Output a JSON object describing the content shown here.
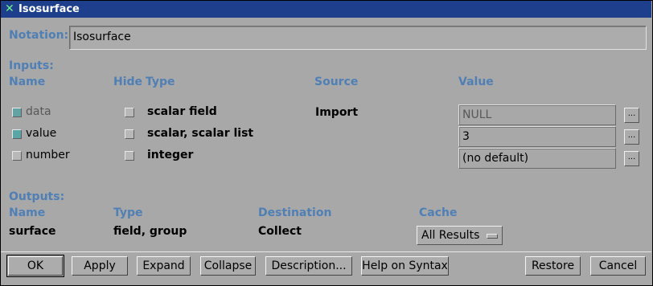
{
  "window": {
    "title": "Isosurface",
    "app_icon": "x-icon"
  },
  "notation": {
    "label": "Notation:",
    "value": "Isosurface"
  },
  "inputs": {
    "section_label": "Inputs:",
    "headers": {
      "name": "Name",
      "hide": "Hide",
      "type": "Type",
      "source": "Source",
      "value": "Value"
    },
    "rows": [
      {
        "name": "data",
        "type": "scalar field",
        "source": "Import",
        "value": "NULL",
        "enabled": false,
        "name_checked": true,
        "hide_checked": false
      },
      {
        "name": "value",
        "type": "scalar, scalar list",
        "source": "",
        "value": "3",
        "enabled": true,
        "name_checked": true,
        "hide_checked": false
      },
      {
        "name": "number",
        "type": "integer",
        "source": "",
        "value": "(no default)",
        "enabled": true,
        "name_checked": false,
        "hide_checked": false
      }
    ],
    "ellipsis_label": "..."
  },
  "outputs": {
    "section_label": "Outputs:",
    "headers": {
      "name": "Name",
      "type": "Type",
      "destination": "Destination",
      "cache": "Cache"
    },
    "rows": [
      {
        "name": "surface",
        "type": "field, group",
        "destination": "Collect",
        "cache": "All Results"
      }
    ]
  },
  "buttons": {
    "ok": "OK",
    "apply": "Apply",
    "expand": "Expand",
    "collapse": "Collapse",
    "description": "Description...",
    "help": "Help on Syntax",
    "restore": "Restore",
    "cancel": "Cancel"
  },
  "colors": {
    "title_bar": "#1e3f8c",
    "label": "#4f7fb5",
    "checkbox_on": "#5aa5a5"
  }
}
